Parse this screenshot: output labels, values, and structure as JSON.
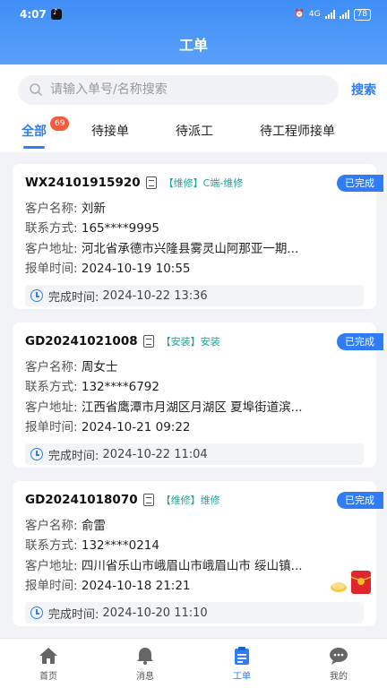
{
  "status_bar": {
    "time": "4:07",
    "network": "4G",
    "battery": "78"
  },
  "header": {
    "title": "工单"
  },
  "search": {
    "placeholder": "请输入单号/名称搜索",
    "button_label": "搜索"
  },
  "tabs": [
    {
      "label": "全部",
      "badge": "69",
      "active": true
    },
    {
      "label": "待接单"
    },
    {
      "label": "待派工"
    },
    {
      "label": "待工程师接单"
    }
  ],
  "labels": {
    "customer": "客户名称:",
    "contact": "联系方式:",
    "address": "客户地址:",
    "report_time": "报单时间:",
    "finish_time": "完成时间:"
  },
  "orders": [
    {
      "order_no": "WX24101915920",
      "tag": "【维修】C端-维修",
      "status": "已完成",
      "customer": "刘新",
      "contact": "165****9995",
      "address": "河北省承德市兴隆县雾灵山阿那亚一期...",
      "report_time": "2024-10-19 10:55",
      "finish_time": "2024-10-22 13:36"
    },
    {
      "order_no": "GD20241021008",
      "tag": "【安装】安装",
      "status": "已完成",
      "customer": "周女士",
      "contact": "132****6792",
      "address": "江西省鹰潭市月湖区月湖区 夏埠街道滨...",
      "report_time": "2024-10-21 09:22",
      "finish_time": "2024-10-22 11:04"
    },
    {
      "order_no": "GD20241018070",
      "tag": "【维修】维修",
      "status": "已完成",
      "customer": "俞雷",
      "contact": "132****0214",
      "address": "四川省乐山市峨眉山市峨眉山市 绥山镇...",
      "report_time": "2024-10-18 21:21",
      "finish_time": "2024-10-20 11:10"
    }
  ],
  "bottom_nav": [
    {
      "label": "首页",
      "icon": "home-icon"
    },
    {
      "label": "消息",
      "icon": "bell-icon"
    },
    {
      "label": "工单",
      "icon": "clipboard-icon",
      "active": true
    },
    {
      "label": "我的",
      "icon": "chat-bubble-icon"
    }
  ],
  "colors": {
    "primary": "#2f7cf6",
    "badge": "#f25c3c",
    "tag": "#1aa39a"
  }
}
